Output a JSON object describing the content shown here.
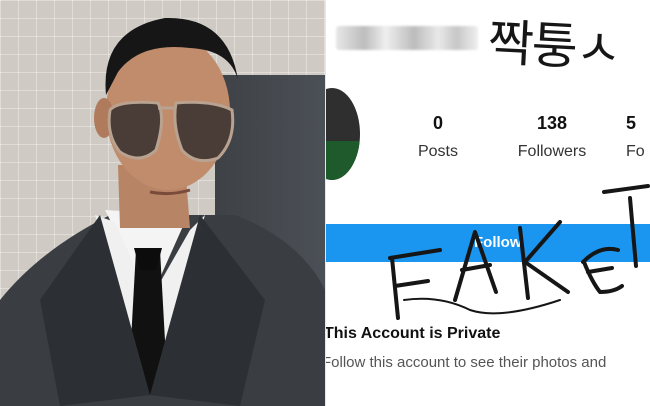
{
  "profile": {
    "stats": [
      {
        "value": "0",
        "label": "Posts"
      },
      {
        "value": "138",
        "label": "Followers"
      },
      {
        "value": "5",
        "label": "Fo"
      }
    ],
    "follow_label": "Follow",
    "private_title": "This Account is Private",
    "private_subtitle": "Follow this account to see their photos and"
  },
  "annotations": {
    "korean_text": "짝퉁ㅅ",
    "fake_text": "FAKE"
  },
  "colors": {
    "follow_button": "#1a95f0",
    "handwriting": "#161616"
  }
}
